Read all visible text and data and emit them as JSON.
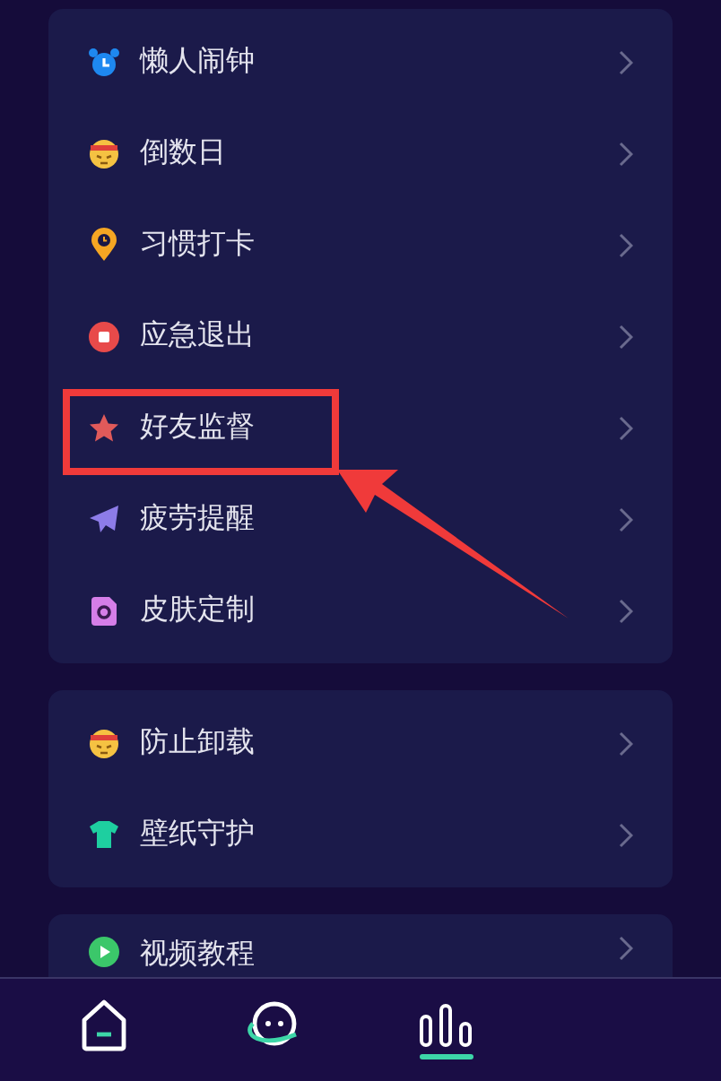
{
  "groups": [
    {
      "items": [
        {
          "label": "懒人闹钟",
          "kind": "alarm",
          "highlighted": false
        },
        {
          "label": "倒数日",
          "kind": "emoji",
          "highlighted": false
        },
        {
          "label": "习惯打卡",
          "kind": "pin",
          "highlighted": false
        },
        {
          "label": "应急退出",
          "kind": "stop",
          "highlighted": false
        },
        {
          "label": "好友监督",
          "kind": "star",
          "highlighted": true
        },
        {
          "label": "疲劳提醒",
          "kind": "plane",
          "highlighted": false
        },
        {
          "label": "皮肤定制",
          "kind": "skin",
          "highlighted": false
        }
      ]
    },
    {
      "items": [
        {
          "label": "防止卸载",
          "kind": "emoji",
          "highlighted": false
        },
        {
          "label": "壁纸守护",
          "kind": "shirt",
          "highlighted": false
        }
      ]
    },
    {
      "items": [
        {
          "label": "视频教程",
          "kind": "play",
          "highlighted": false
        }
      ]
    }
  ],
  "nav": [
    {
      "kind": "home",
      "selected": false
    },
    {
      "kind": "planet",
      "selected": false
    },
    {
      "kind": "stats",
      "selected": true
    }
  ]
}
